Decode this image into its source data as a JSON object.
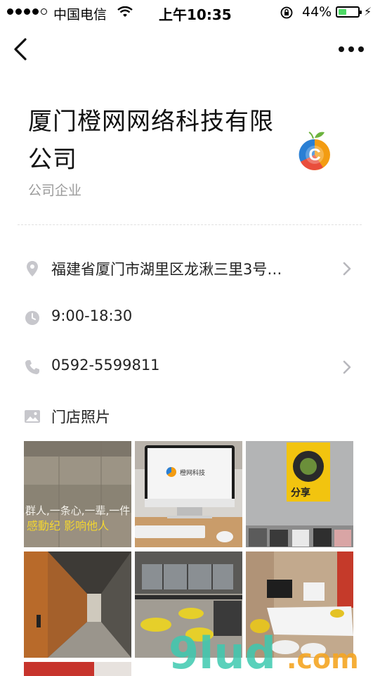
{
  "status_bar": {
    "carrier": "中国电信",
    "time": "上午10:35",
    "battery_percent": "44%",
    "battery_level": 0.44,
    "signal_bars_filled": 4,
    "signal_bars_total": 5
  },
  "nav": {
    "back_icon": "chevron-left-icon",
    "more_icon": "more-dots-icon"
  },
  "business": {
    "name_line1": "厦门橙网网络科技有限",
    "name_line2": "公司",
    "category": "公司企业",
    "logo_letter": "C"
  },
  "info": {
    "address": "福建省厦门市湖里区龙湫三里3号…",
    "hours": "9:00-18:30",
    "phone": "0592-5599811",
    "photos_label": "门店照片"
  },
  "gallery": {
    "photos": [
      {
        "icon": "photo-wall-lettering",
        "caption_line1": "群人,一条心,一辈,一件",
        "caption_line2": "感動纪 影响他人"
      },
      {
        "icon": "photo-imac-desk",
        "screen_text": "橙网科技"
      },
      {
        "icon": "photo-poster-wall",
        "poster_text": "分享"
      },
      {
        "icon": "photo-hallway"
      },
      {
        "icon": "photo-lounge"
      },
      {
        "icon": "photo-meeting-room"
      }
    ]
  },
  "watermark": {
    "text_main": "9lud",
    "text_suffix": ".com"
  },
  "colors": {
    "accent_orange": "#f39c12",
    "logo_blue": "#2a7fd4",
    "battery_green": "#4cd964",
    "icon_gray": "#c7c7cc",
    "watermark_teal": "#3ec9b0",
    "watermark_orange": "#f5a623"
  }
}
